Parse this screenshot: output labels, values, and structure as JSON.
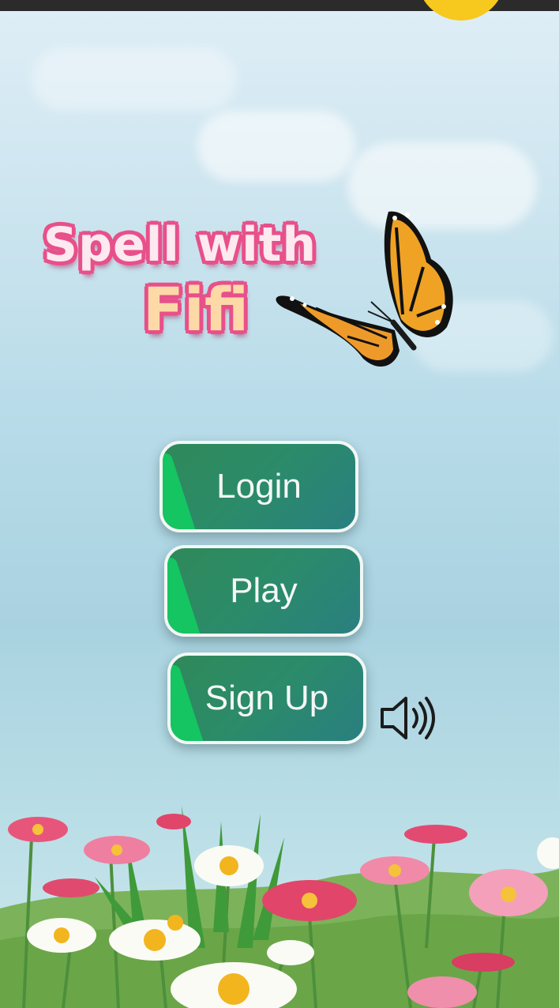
{
  "title": {
    "line1": "Spell with",
    "line2": "Fifi"
  },
  "menu": {
    "login_label": "Login",
    "play_label": "Play",
    "signup_label": "Sign Up"
  },
  "icons": {
    "sound": "speaker-icon",
    "mascot": "butterfly-icon"
  },
  "colors": {
    "button_green": "#2b8b6a",
    "button_accent": "#14c562",
    "title_outline": "#e8508a",
    "sky": "#b9dce9",
    "sun": "#f7c81e"
  }
}
